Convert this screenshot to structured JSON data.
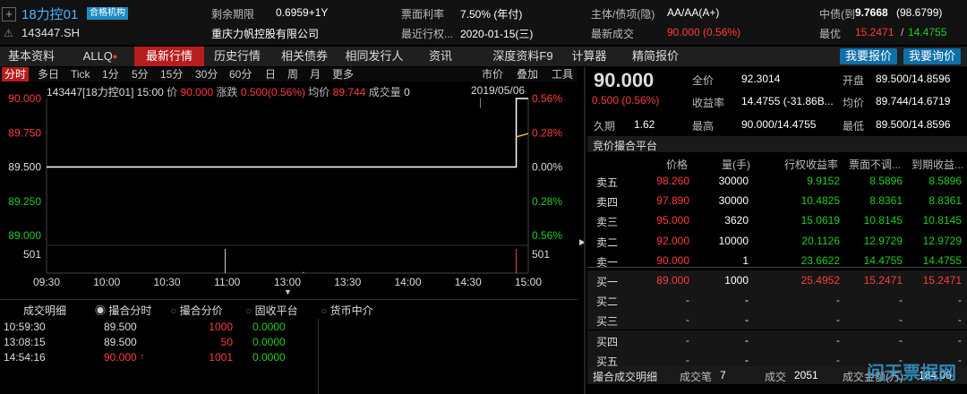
{
  "header": {
    "name": "18力控01",
    "badge": "合格机构",
    "code": "143447.SH",
    "fields": [
      {
        "label": "剩余期限",
        "value": "0.6959+1Y"
      },
      {
        "label": "票面利率",
        "value": "7.50% (年付)"
      },
      {
        "label": "主体/债项(隐)",
        "value": "AA/AA(A+)"
      },
      {
        "label": "中债(到",
        "value": "9.7668",
        "extra": "(98.6799)"
      },
      {
        "label": "",
        "value": "重庆力帆控股有限公司"
      },
      {
        "label": "最近行权...",
        "value": "2020-01-15(三)"
      },
      {
        "label": "最新成交",
        "value": "90.000 (0.56%)"
      },
      {
        "label": "最优",
        "value": "15.2471",
        "value2": "14.4755"
      }
    ]
  },
  "menu": {
    "items": [
      "基本资料",
      "ALLQ",
      "最新行情",
      "历史行情",
      "相关债券",
      "相同发行人",
      "资讯",
      "深度资料F9",
      "计算器",
      "精简报价"
    ],
    "active": "最新行情",
    "btn_quote": "我要报价",
    "btn_inquiry": "我要询价"
  },
  "chart_tabs": {
    "items": [
      "分时",
      "多日",
      "Tick",
      "1分",
      "5分",
      "15分",
      "30分",
      "60分",
      "日",
      "周",
      "月",
      "更多"
    ],
    "active": "分时",
    "right": [
      "市价",
      "叠加",
      "工具"
    ]
  },
  "chart_info": {
    "code": "143447[18力控01]",
    "time": "15:00",
    "price_label": "价",
    "price": "90.000",
    "change_label": "涨跌",
    "change": "0.500(0.56%)",
    "avg_label": "均价",
    "avg": "89.744",
    "vol_label": "成交量",
    "vol": "0",
    "date": "2019/05/06"
  },
  "chart_data": {
    "type": "line",
    "x_ticks": [
      "09:30",
      "10:00",
      "10:30",
      "11:00",
      "13:00",
      "13:30",
      "14:00",
      "14:30",
      "15:00"
    ],
    "y_ticks_left": [
      "90.000",
      "89.750",
      "89.500",
      "89.250",
      "89.000"
    ],
    "y_ticks_right": [
      "0.56%",
      "0.28%",
      "0.00%",
      "0.28%",
      "0.56%"
    ],
    "ylim": [
      89.0,
      90.0
    ],
    "series": [
      {
        "x": [
          "09:30",
          "14:54",
          "14:54",
          "15:00"
        ],
        "values": [
          89.5,
          89.5,
          90.0,
          90.0
        ]
      }
    ],
    "volume_label": "501",
    "volume_label_right": "501",
    "volume_bars": [
      {
        "x": "10:59",
        "value": 1000
      },
      {
        "x": "13:08",
        "value": 50
      },
      {
        "x": "14:54",
        "value": 1001
      }
    ]
  },
  "trade_tabs": {
    "title": "成交明细",
    "options": [
      "撮合分时",
      "撮合分价",
      "固收平台",
      "货币中介"
    ],
    "selected": "撮合分时"
  },
  "trades": [
    {
      "time": "10:59:30",
      "price": "89.500",
      "arrow": "",
      "qty": "1000",
      "yld": "0.0000"
    },
    {
      "time": "13:08:15",
      "price": "89.500",
      "arrow": "",
      "qty": "50",
      "yld": "0.0000"
    },
    {
      "time": "14:54:16",
      "price": "90.000",
      "arrow": "↑",
      "qty": "1001",
      "yld": "0.0000"
    }
  ],
  "quote": {
    "last": "90.000",
    "change": "0.500 (0.56%)",
    "full_label": "全价",
    "full": "92.3014",
    "open_label": "开盘",
    "open": "89.500/14.8596",
    "yield_label": "收益率",
    "yield": "14.4755 (-31.86B...",
    "avg_label": "均价",
    "avg": "89.744/14.6719",
    "dur_label": "久期",
    "dur": "1.62",
    "high_label": "最高",
    "high": "90.000/14.4755",
    "low_label": "最低",
    "low": "89.500/14.8596"
  },
  "orderbook": {
    "title": "竞价撮合平台",
    "headers": [
      "价格",
      "量(手)",
      "行权收益率",
      "票面不调...",
      "到期收益..."
    ],
    "asks": [
      {
        "label": "卖五",
        "price": "98.260",
        "qty": "30000",
        "y1": "9.9152",
        "y2": "8.5896",
        "y3": "8.5896"
      },
      {
        "label": "卖四",
        "price": "97.890",
        "qty": "30000",
        "y1": "10.4825",
        "y2": "8.8361",
        "y3": "8.8361"
      },
      {
        "label": "卖三",
        "price": "95.000",
        "qty": "3620",
        "y1": "15.0619",
        "y2": "10.8145",
        "y3": "10.8145"
      },
      {
        "label": "卖二",
        "price": "92.000",
        "qty": "10000",
        "y1": "20.1126",
        "y2": "12.9729",
        "y3": "12.9729"
      },
      {
        "label": "卖一",
        "price": "90.000",
        "qty": "1",
        "y1": "23.6622",
        "y2": "14.4755",
        "y3": "14.4755"
      }
    ],
    "bids": [
      {
        "label": "买一",
        "price": "89.000",
        "qty": "1000",
        "y1": "25.4952",
        "y2": "15.2471",
        "y3": "15.2471"
      },
      {
        "label": "买二",
        "price": "-",
        "qty": "-",
        "y1": "-",
        "y2": "-",
        "y3": "-"
      },
      {
        "label": "买三",
        "price": "-",
        "qty": "-",
        "y1": "-",
        "y2": "-",
        "y3": "-"
      },
      {
        "label": "买四",
        "price": "-",
        "qty": "-",
        "y1": "-",
        "y2": "-",
        "y3": "-"
      },
      {
        "label": "买五",
        "price": "-",
        "qty": "-",
        "y1": "-",
        "y2": "-",
        "y3": "-"
      }
    ]
  },
  "footer": {
    "title": "撮合成交明细",
    "count_label": "成交笔",
    "count": "7",
    "deal_label": "成交",
    "deal": "2051",
    "amount_label": "成交金额(万)",
    "amount": "184.06"
  },
  "watermark": "问天票据网",
  "colors": {
    "up": "#ff3b3b",
    "down": "#22cc22",
    "accent": "#b71d1d",
    "button": "#0f6fa8"
  }
}
